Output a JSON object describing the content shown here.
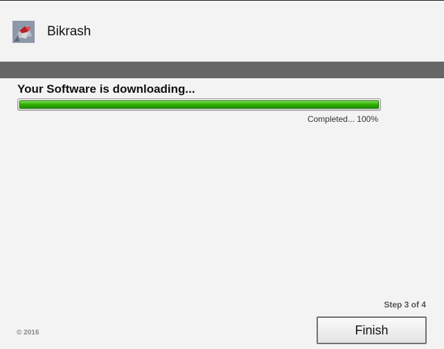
{
  "header": {
    "app_name": "Bikrash",
    "icon": "app-logo-icon"
  },
  "download": {
    "status_title": "Your Software is downloading...",
    "progress_label": "Completed... 100%",
    "progress_percent": 100,
    "progress_color": "#33b000"
  },
  "footer": {
    "step_label": "Step 3 of 4",
    "copyright": "© 2016",
    "finish_label": "Finish"
  },
  "colors": {
    "background": "#f3f3f3",
    "divider": "#666666"
  }
}
